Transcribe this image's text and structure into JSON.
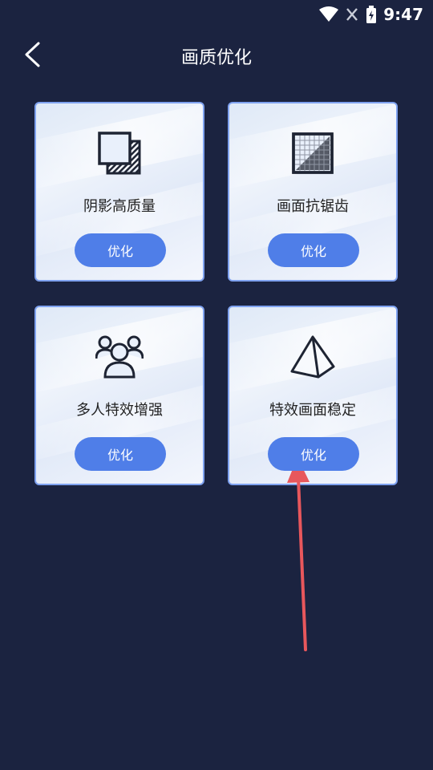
{
  "status_bar": {
    "time": "9:47"
  },
  "header": {
    "title": "画质优化"
  },
  "cards": [
    {
      "label": "阴影高质量",
      "button": "优化",
      "icon": "shadow-squares-icon"
    },
    {
      "label": "画面抗锯齿",
      "button": "优化",
      "icon": "antialias-grid-icon"
    },
    {
      "label": "多人特效增强",
      "button": "优化",
      "icon": "multi-user-icon"
    },
    {
      "label": "特效画面稳定",
      "button": "优化",
      "icon": "pyramid-icon"
    }
  ],
  "colors": {
    "background": "#1b2340",
    "button": "#4f7ee8",
    "card_border": "#7fa2f0",
    "annotation_arrow": "#e8575c"
  }
}
